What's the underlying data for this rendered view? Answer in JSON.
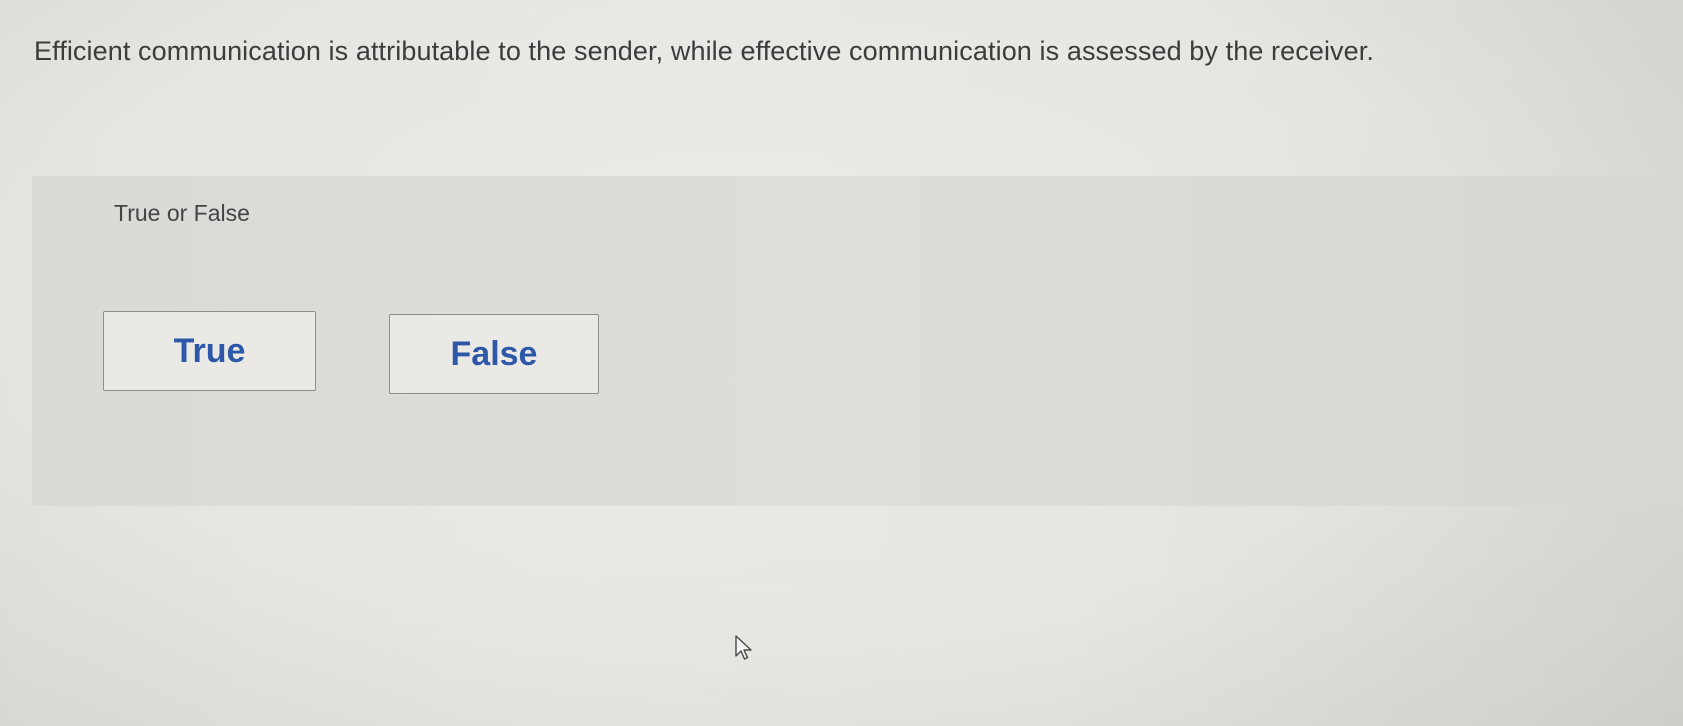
{
  "question": {
    "text": "Efficient communication is attributable to the sender, while effective communication is assessed by the receiver."
  },
  "answer_area": {
    "prompt": "True or False",
    "choices": [
      {
        "label": "True"
      },
      {
        "label": "False"
      }
    ]
  },
  "colors": {
    "choice_text": "#2d58a8",
    "choice_border": "#8e8e8e",
    "panel_bg": "#dcdad6",
    "page_bg": "#e8e6e1"
  },
  "icons": {
    "cursor": "mouse-pointer-icon"
  }
}
